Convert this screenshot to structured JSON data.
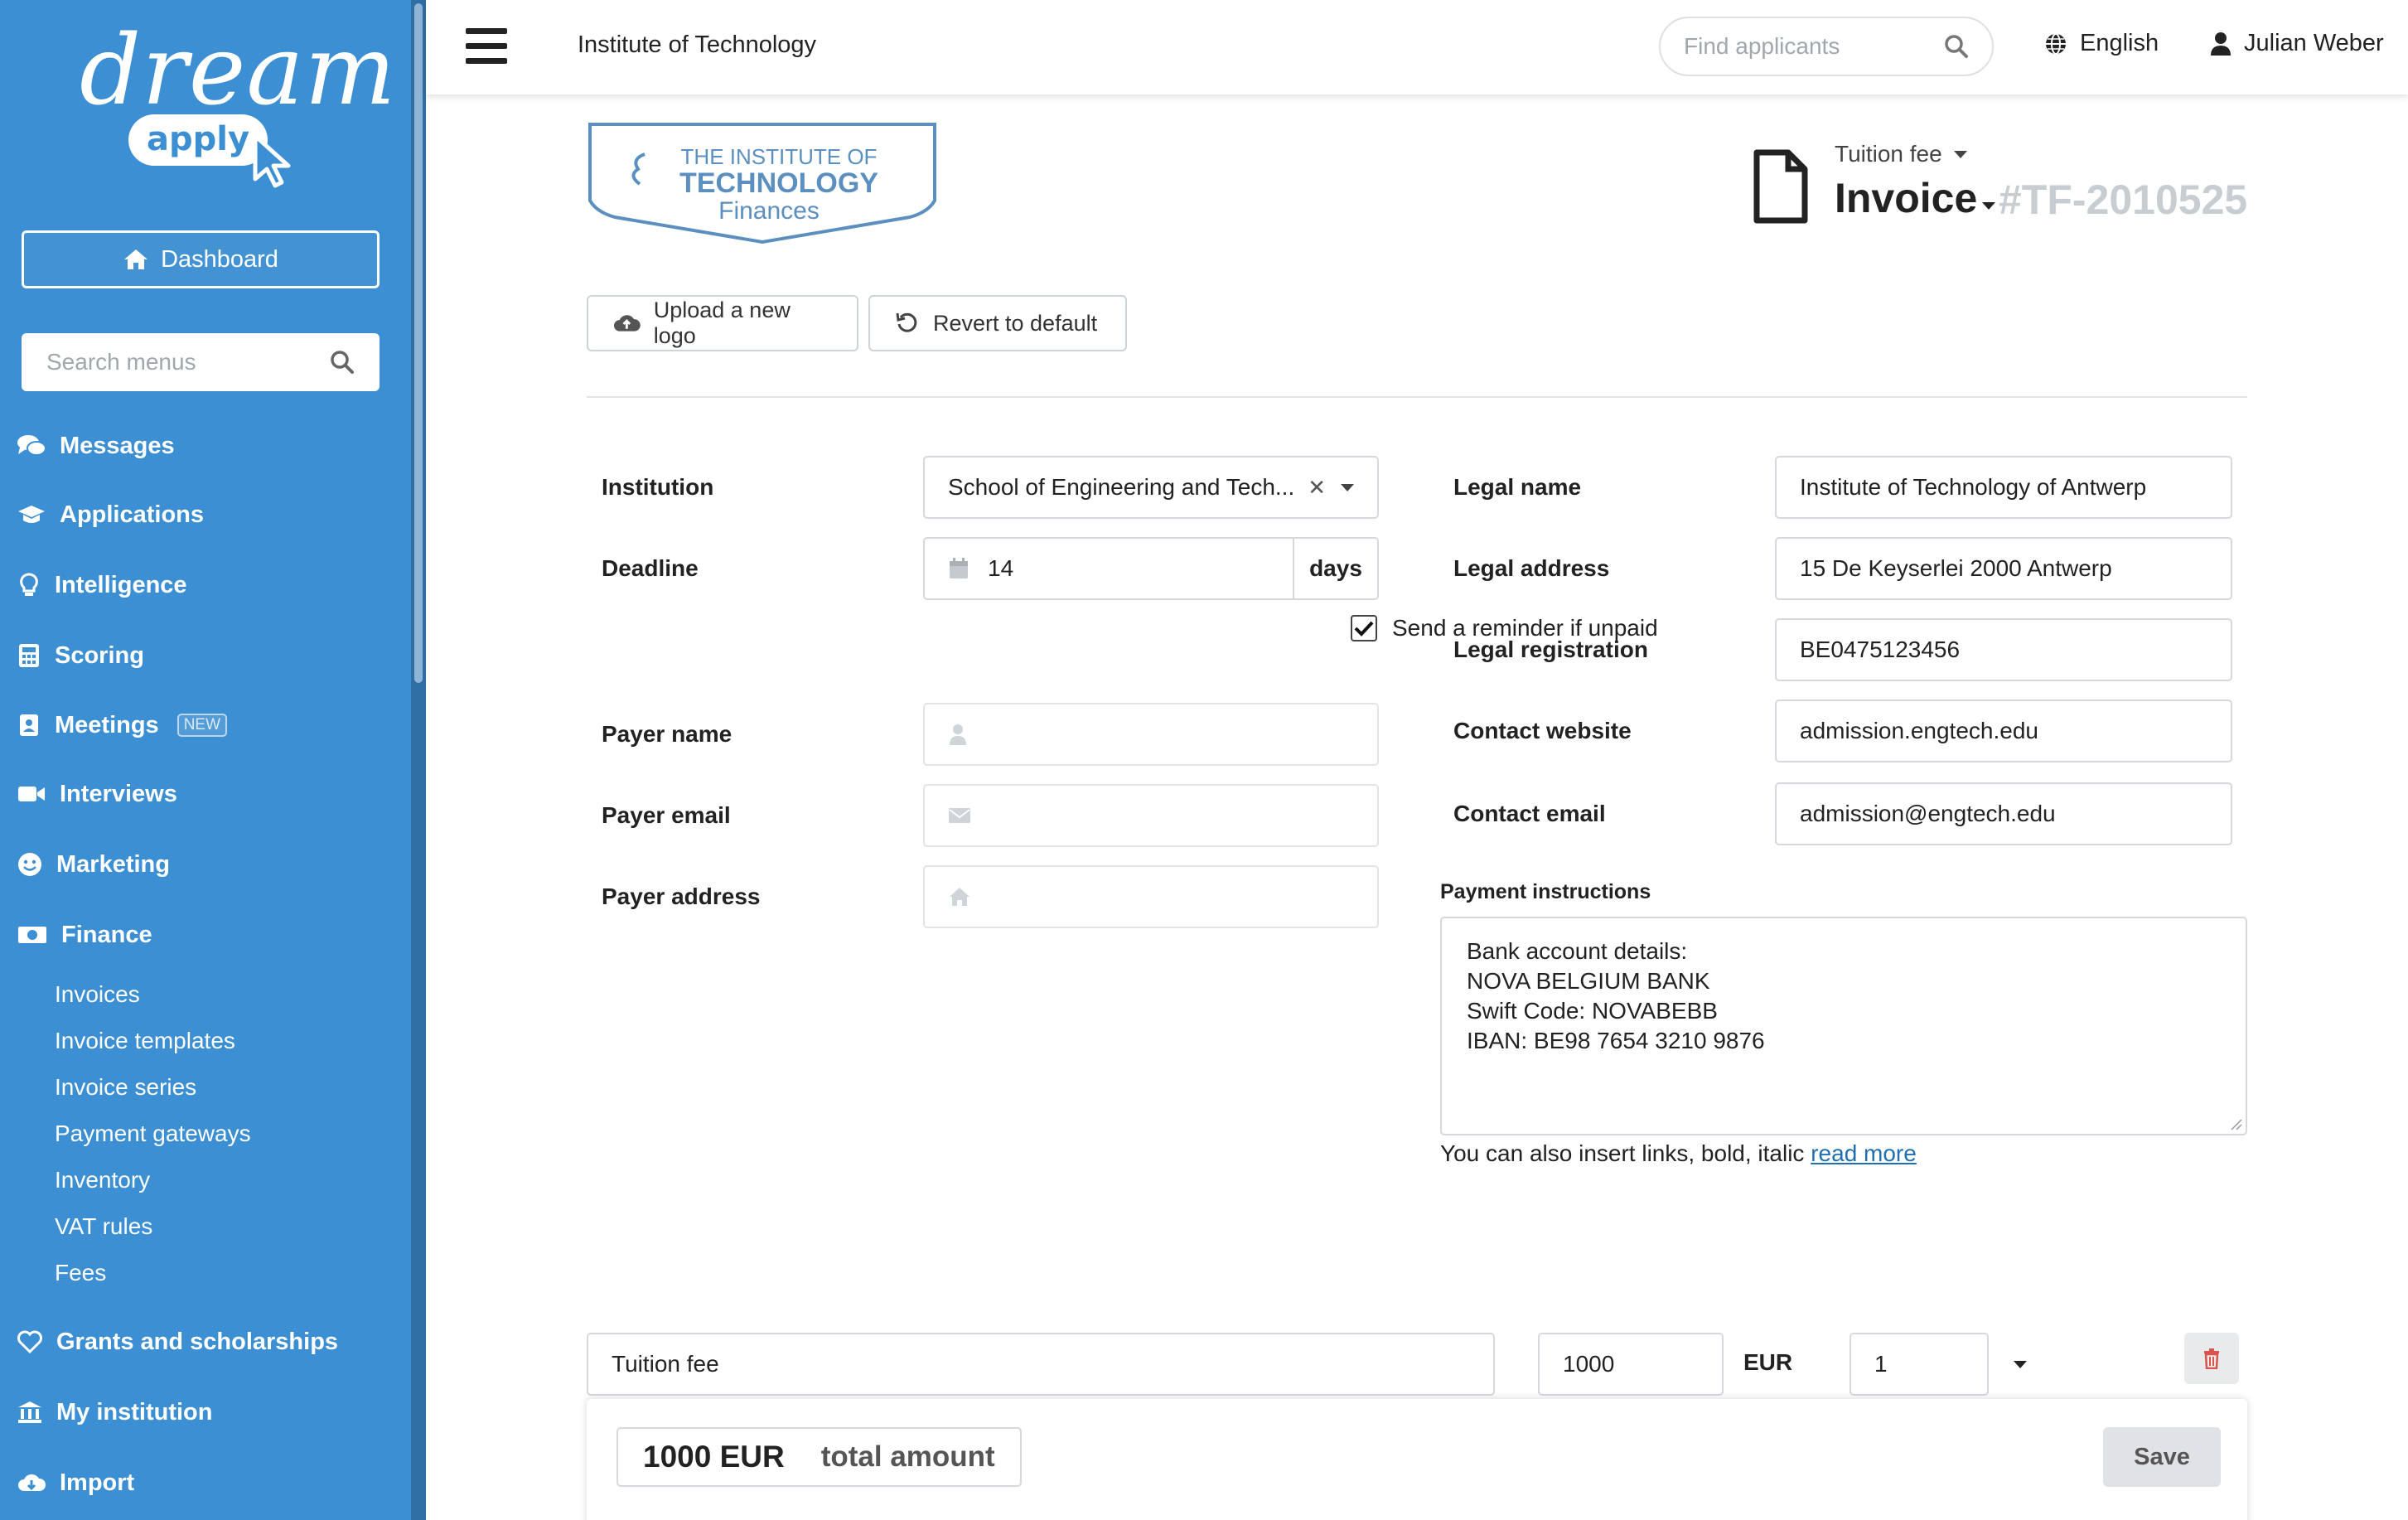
{
  "brand": {
    "name_top": "dream",
    "name_bottom": "apply"
  },
  "sidebar": {
    "dashboard_label": "Dashboard",
    "search_placeholder": "Search menus",
    "items": [
      {
        "label": "Messages",
        "icon": "comments-icon"
      },
      {
        "label": "Applications",
        "icon": "graduation-cap-icon"
      },
      {
        "label": "Intelligence",
        "icon": "lightbulb-icon"
      },
      {
        "label": "Scoring",
        "icon": "calculator-icon"
      },
      {
        "label": "Meetings",
        "icon": "meeting-badge-icon",
        "badge": "NEW"
      },
      {
        "label": "Interviews",
        "icon": "video-camera-icon"
      },
      {
        "label": "Marketing",
        "icon": "smile-icon"
      },
      {
        "label": "Finance",
        "icon": "money-bill-icon"
      },
      {
        "label": "Grants and scholarships",
        "icon": "heart-icon"
      },
      {
        "label": "My institution",
        "icon": "institution-icon"
      },
      {
        "label": "Import",
        "icon": "cloud-download-icon"
      }
    ],
    "finance_sub": [
      "Invoices",
      "Invoice templates",
      "Invoice series",
      "Payment gateways",
      "Inventory",
      "VAT rules",
      "Fees"
    ]
  },
  "topbar": {
    "org_title": "Institute of Technology",
    "search_placeholder": "Find applicants",
    "language": "English",
    "user": "Julian Weber"
  },
  "invoice": {
    "logo_lines": [
      "THE INSTITUTE OF",
      "TECHNOLOGY",
      "Finances"
    ],
    "type_label": "Tuition fee",
    "doc_kind": "Invoice",
    "number": "#TF-2010525",
    "upload_logo": "Upload a new logo",
    "revert_default": "Revert to default"
  },
  "form": {
    "institution_label": "Institution",
    "institution_value": "School of Engineering and Tech...",
    "deadline_label": "Deadline",
    "deadline_value": "14",
    "deadline_unit": "days",
    "reminder_label": "Send a reminder if unpaid",
    "reminder_checked": true,
    "payer_name_label": "Payer name",
    "payer_email_label": "Payer email",
    "payer_address_label": "Payer address",
    "legal_name_label": "Legal name",
    "legal_name_value": "Institute of Technology of Antwerp",
    "legal_address_label": "Legal address",
    "legal_address_value": "15 De Keyserlei 2000 Antwerp",
    "legal_reg_label": "Legal registration",
    "legal_reg_value": "BE0475123456",
    "contact_web_label": "Contact website",
    "contact_web_value": "admission.engtech.edu",
    "contact_email_label": "Contact email",
    "contact_email_value": "admission@engtech.edu",
    "payment_instr_label": "Payment instructions",
    "payment_instr_lines": [
      "Bank account details:",
      "",
      "NOVA BELGIUM BANK",
      "Swift Code: NOVABEBB",
      "IBAN: BE98 7654 3210 9876"
    ],
    "help_text": "You can also insert links, bold, italic ",
    "help_link": "read more"
  },
  "line_item": {
    "description": "Tuition fee",
    "amount": "1000",
    "currency": "EUR",
    "quantity": "1"
  },
  "footer": {
    "total_amount": "1000 EUR",
    "total_label": "total amount",
    "save_label": "Save"
  },
  "colors": {
    "sidebar": "#3c8fd3",
    "link": "#1f6fb2",
    "logo_blue": "#5b8fbf"
  }
}
